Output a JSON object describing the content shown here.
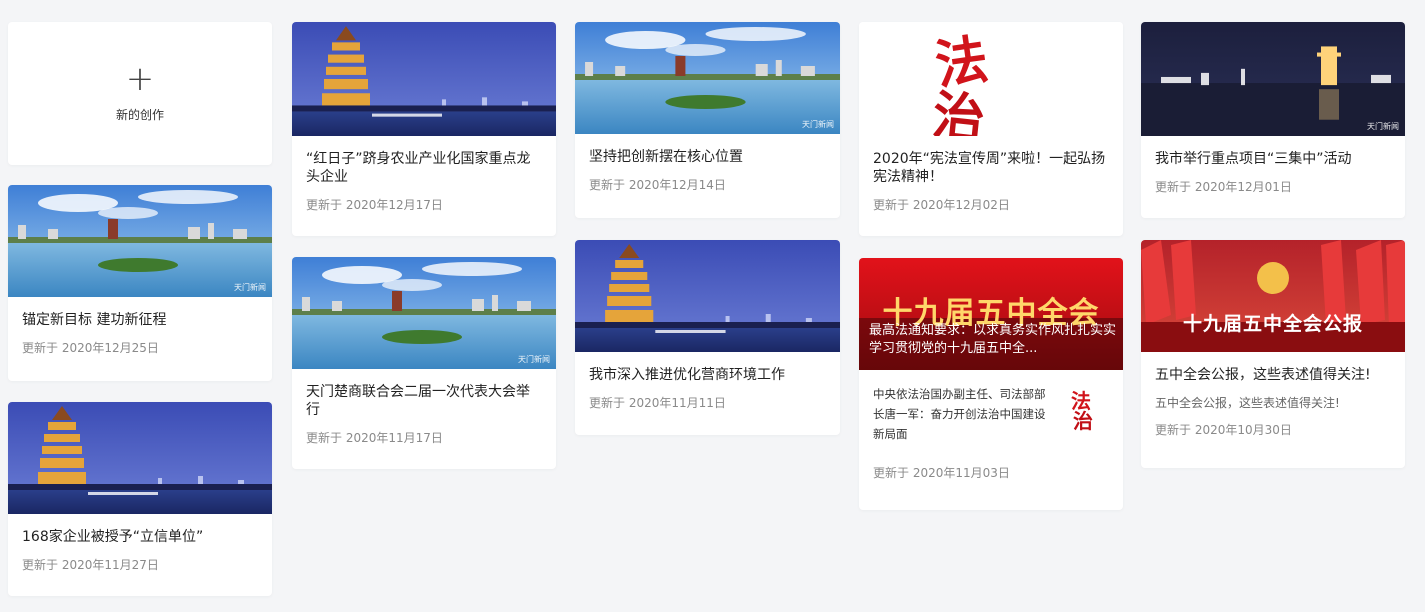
{
  "new_card": {
    "icon": "plus-icon",
    "label": "新的创作"
  },
  "watermark": "天门新闻",
  "cards": [
    {
      "title": "锚定新目标 建功新征程",
      "date": "更新于 2020年12月25日",
      "image": "lake-skyline"
    },
    {
      "title": "168家企业被授予“立信单位”",
      "date": "更新于 2020年11月27日",
      "image": "tower-night"
    },
    {
      "title": "“红日子”跻身农业产业化国家重点龙头企业",
      "date": "更新于 2020年12月17日",
      "image": "tower-night"
    },
    {
      "title": "天门楚商联合会二届一次代表大会举行",
      "date": "更新于 2020年11月17日",
      "image": "lake-skyline"
    },
    {
      "title": "坚持把创新摆在核心位置",
      "date": "更新于 2020年12月14日",
      "image": "lake-skyline"
    },
    {
      "title": "我市深入推进优化营商环境工作",
      "date": "更新于 2020年11月11日",
      "image": "tower-night"
    },
    {
      "title": "2020年“宪法宣传周”来啦！一起弘扬宪法精神！",
      "date": "更新于 2020年12月02日",
      "image": "law-characters"
    },
    {
      "banner_big": "十九届五中全会",
      "banner_text": "最高法通知要求：以求真务实作风扎扎实实学习贯彻党的十九届五中全...",
      "sub_text": "中央依法治国办副主任、司法部部长唐一军：奋力开创法治中国建设新局面",
      "date": "更新于 2020年11月03日",
      "image": "red-banner"
    },
    {
      "title": "我市举行重点项目“三集中”活动",
      "date": "更新于 2020年12月01日",
      "image": "night-city"
    },
    {
      "banner": "十九届五中全会公报",
      "title": "五中全会公报，这些表述值得关注!",
      "desc": "五中全会公报，这些表述值得关注!",
      "date": "更新于 2020年10月30日",
      "image": "red-flags"
    }
  ]
}
